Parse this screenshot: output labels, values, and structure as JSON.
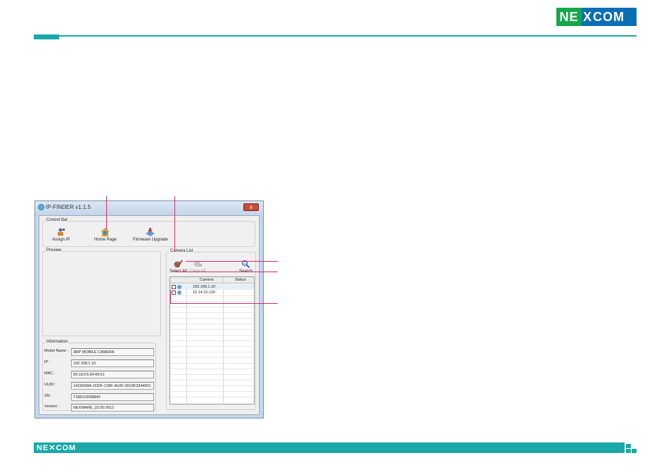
{
  "brand": {
    "logo_ne": "NE",
    "logo_x": "X",
    "logo_com": "COM",
    "footer_logo": "NE✕COM"
  },
  "window": {
    "title": "IP-FINDER v1.1.5",
    "close_label": "x"
  },
  "control_bar": {
    "label": "Control Bar",
    "tools": [
      {
        "label": "Assign IP",
        "icon": "assign-ip-icon"
      },
      {
        "label": "Home Page",
        "icon": "home-icon"
      },
      {
        "label": "Firmware Upgrade",
        "icon": "firmware-upgrade-icon"
      }
    ]
  },
  "preview": {
    "label": "Preview"
  },
  "information": {
    "label": "Information",
    "fields": [
      {
        "label": "Model Name :",
        "value": "3MP MOBILE CAMERA"
      },
      {
        "label": "IP :",
        "value": "192.168.1.10"
      },
      {
        "label": "MAC :",
        "value": "00:10:F3:34:49:01"
      },
      {
        "label": "UUID :",
        "value": "1419D68A-1DDF-11BF-A10F-0010F3344901"
      },
      {
        "label": "SN :",
        "value": "TS8D10008840"
      },
      {
        "label": "Version :",
        "value": "NEXWARE_02.00.0012"
      }
    ]
  },
  "camera_list": {
    "label": "Camera List",
    "tools": [
      {
        "label": "Select All",
        "icon": "select-all-icon"
      },
      {
        "label": "Clear All",
        "icon": "clear-all-icon",
        "disabled": true
      },
      {
        "label": "Search",
        "icon": "search-icon"
      }
    ],
    "columns": [
      "Camera",
      "Status"
    ],
    "rows": [
      {
        "camera": "192.168.1.10",
        "status": ""
      },
      {
        "camera": "10.14.10.120",
        "status": ""
      }
    ]
  },
  "colors": {
    "accent": "#1aa8a8",
    "callout": "#d6296b",
    "logo_blue": "#0a6eb5",
    "logo_green": "#13a84a"
  }
}
